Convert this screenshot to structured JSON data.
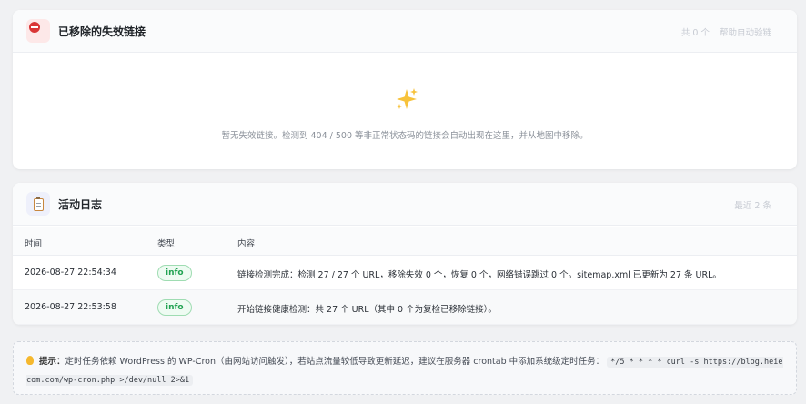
{
  "removed_links": {
    "title": "已移除的失效链接",
    "count_label": "共 0 个",
    "action_label": "帮助自动验链",
    "empty_message": "暂无失效链接。检测到 404 / 500 等非正常状态码的链接会自动出现在这里，并从地图中移除。",
    "icon": "no-entry-icon",
    "empty_icon": "sparkles-icon"
  },
  "activity_log": {
    "title": "活动日志",
    "count_label": "最近 2 条",
    "icon": "clipboard-icon",
    "columns": {
      "time": "时间",
      "type": "类型",
      "content": "内容"
    },
    "rows": [
      {
        "time": "2026-08-27 22:54:34",
        "type": "info",
        "content": "链接检测完成：检测 27 / 27 个 URL，移除失效 0 个，恢复 0 个，网络错误跳过 0 个。sitemap.xml 已更新为 27 条 URL。"
      },
      {
        "time": "2026-08-27 22:53:58",
        "type": "info",
        "content": "开始链接健康检测：共 27 个 URL（其中 0 个为复检已移除链接）。"
      }
    ]
  },
  "tip": {
    "label": "提示：",
    "text": "定时任务依赖 WordPress 的 WP-Cron（由网站访问触发），若站点流量较低导致更新延迟，建议在服务器 crontab 中添加系统级定时任务：",
    "command": "*/5 * * * * curl -s https://blog.heiecom.com/wp-cron.php >/dev/null 2>&1",
    "icon": "lightbulb-icon"
  },
  "colors": {
    "page_bg": "#f0f1f3",
    "badge_green": "#22a352",
    "stop_red": "#d93636"
  }
}
